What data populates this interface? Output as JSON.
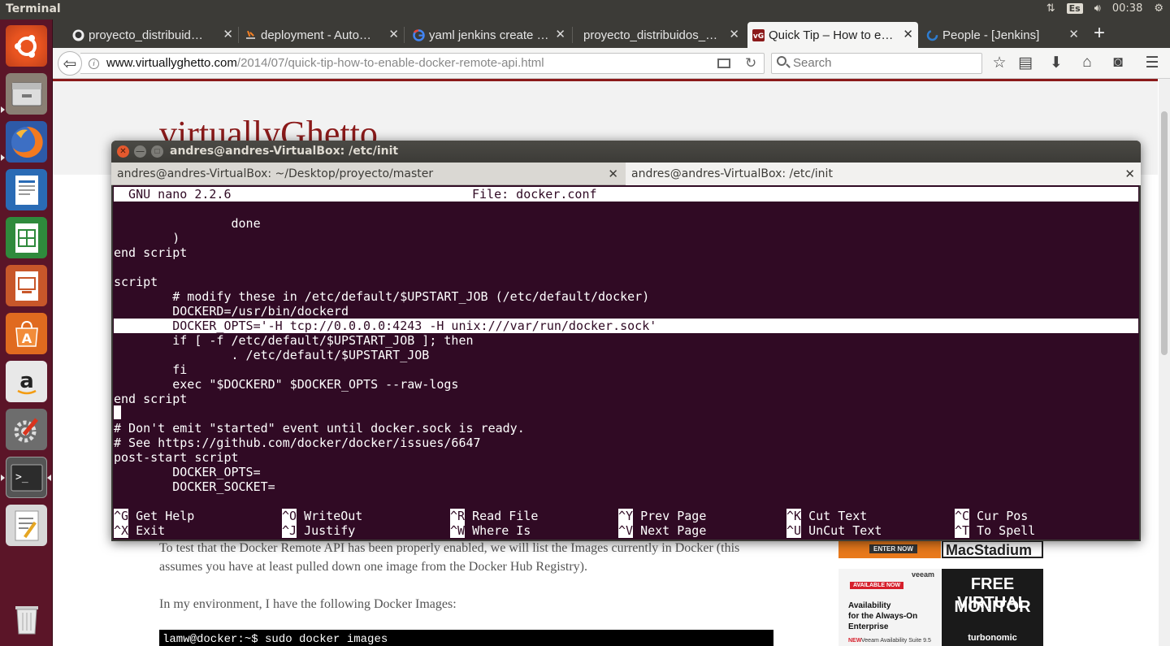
{
  "top_panel": {
    "app_title": "Terminal",
    "keyboard_layout": "Es",
    "clock": "00:38"
  },
  "launcher": {
    "items": [
      "ubuntu-dash-icon",
      "files-icon",
      "firefox-icon",
      "writer-icon",
      "calc-icon",
      "impress-icon",
      "software-center-icon",
      "amazon-icon",
      "system-settings-icon",
      "terminal-icon",
      "text-editor-icon",
      "trash-icon"
    ]
  },
  "browser": {
    "tabs": [
      {
        "label": "proyecto_distribuid…",
        "icon": "github-icon",
        "icon_color": "#333333"
      },
      {
        "label": "deployment - Auto…",
        "icon": "stackoverflow-icon",
        "icon_color": "#f48024"
      },
      {
        "label": "yaml jenkins create …",
        "icon": "google-icon",
        "icon_color": "#4285f4"
      },
      {
        "label": "proyecto_distribuidos_…",
        "icon": "none",
        "icon_color": ""
      },
      {
        "label": "Quick Tip – How to e…",
        "icon": "vg-icon",
        "icon_color": "#8b1a1a"
      },
      {
        "label": "People - [Jenkins]",
        "icon": "jenkins-icon",
        "icon_color": "#2e7dd1"
      }
    ],
    "url_host": "www.virtuallyghetto.com",
    "url_path": "/2014/07/quick-tip-how-to-enable-docker-remote-api.html",
    "search_placeholder": "Search"
  },
  "webpage": {
    "site_title": "virtuallyGhetto",
    "paragraph1_line1": "To test that the Docker Remote API has been properly enabled, we will list the Images currently in Docker (this",
    "paragraph1_line2": "assumes you have at least pulled down one image from the Docker Hub Registry).",
    "paragraph2": "In my environment, I have the following Docker Images:",
    "code_prompt": "lamw@docker:~$ sudo docker images",
    "ad1_button": "ENTER NOW",
    "ad1_brand": "MacStadium",
    "ad2_badge": "AVAILABLE NOW",
    "ad2_brand": "veeam",
    "ad2_line1": "Availability",
    "ad2_line2": "for the Always-On",
    "ad2_line3": "Enterprise",
    "ad2_new": "NEW",
    "ad2_footer": "Veeam Availability Suite 9.5",
    "ad3_line1": "FREE VIRTUAL",
    "ad3_line2": "MONITOR",
    "ad3_brand": "turbonomic"
  },
  "terminal": {
    "window_title": "andres@andres-VirtualBox: /etc/init",
    "tabs": [
      {
        "label": "andres@andres-VirtualBox: ~/Desktop/proyecto/master"
      },
      {
        "label": "andres@andres-VirtualBox: /etc/init"
      }
    ],
    "nano_header_left": "  GNU nano 2.2.6",
    "nano_header_file": "File: docker.conf",
    "lines": [
      "",
      "                done",
      "        )",
      "end script",
      "",
      "script",
      "        # modify these in /etc/default/$UPSTART_JOB (/etc/default/docker)",
      "        DOCKERD=/usr/bin/dockerd",
      "        DOCKER_OPTS='-H tcp://0.0.0.0:4243 -H unix:///var/run/docker.sock'",
      "        if [ -f /etc/default/$UPSTART_JOB ]; then",
      "                . /etc/default/$UPSTART_JOB",
      "        fi",
      "        exec \"$DOCKERD\" $DOCKER_OPTS --raw-logs",
      "end script",
      "",
      "# Don't emit \"started\" event until docker.sock is ready.",
      "# See https://github.com/docker/docker/issues/6647",
      "post-start script",
      "        DOCKER_OPTS=",
      "        DOCKER_SOCKET="
    ],
    "shortcuts": [
      {
        "key": "^G",
        "label": "Get Help"
      },
      {
        "key": "^O",
        "label": "WriteOut"
      },
      {
        "key": "^R",
        "label": "Read File"
      },
      {
        "key": "^Y",
        "label": "Prev Page"
      },
      {
        "key": "^K",
        "label": "Cut Text"
      },
      {
        "key": "^C",
        "label": "Cur Pos"
      },
      {
        "key": "^X",
        "label": "Exit"
      },
      {
        "key": "^J",
        "label": "Justify"
      },
      {
        "key": "^W",
        "label": "Where Is"
      },
      {
        "key": "^V",
        "label": "Next Page"
      },
      {
        "key": "^U",
        "label": "UnCut Text"
      },
      {
        "key": "^T",
        "label": "To Spell"
      }
    ]
  }
}
